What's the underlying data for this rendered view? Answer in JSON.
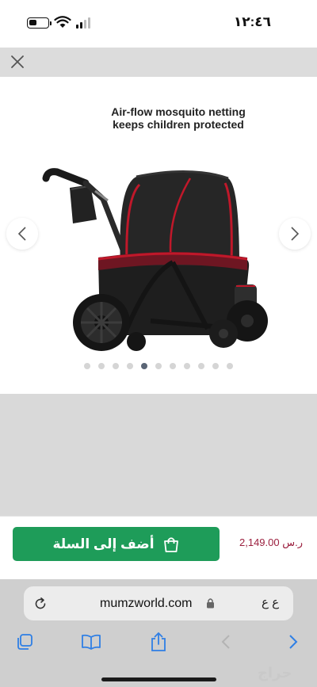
{
  "status_bar": {
    "time": "١٢:٤٦",
    "battery_level": 0.45,
    "signal_bars_active": 2,
    "signal_bars_total": 4
  },
  "header": {
    "close_icon": "close-icon"
  },
  "gallery": {
    "caption_line1": "Air-flow mosquito netting",
    "caption_line2": "keeps children protected",
    "total_images": 11,
    "active_index": 4,
    "prev_icon": "chevron-left-icon",
    "next_icon": "chevron-right-icon"
  },
  "cart": {
    "add_to_cart_label": "أضف إلى السلة",
    "price": "2,149.00 ر.س",
    "button_color": "#1e9c59",
    "price_color": "#9b1f3e"
  },
  "browser": {
    "url": "mumzworld.com",
    "text_size_button": "ع ع",
    "accent_color": "#2f7fe5"
  },
  "watermark": "حراج"
}
